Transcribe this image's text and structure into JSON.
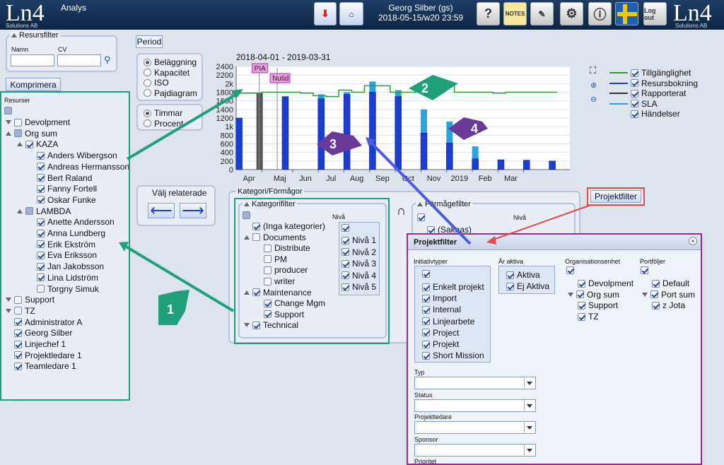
{
  "header": {
    "logo": "Ln4",
    "logo_sub": "Solutions AB",
    "app_name": "Analys",
    "user": "Georg Silber (gs)",
    "datetime": "2018-05-15/w20 23:59",
    "logout_label": "Log out"
  },
  "resource_filter": {
    "title": "Resursfilter",
    "name_label": "Namn",
    "cv_label": "CV",
    "compress_button": "Komprimera"
  },
  "resources": {
    "header": "Resurser",
    "items": [
      {
        "label": "Devolpment",
        "indent": 1,
        "checked": "off",
        "toggle": "collapsed"
      },
      {
        "label": "Org sum",
        "indent": 1,
        "checked": "part",
        "toggle": "expanded"
      },
      {
        "label": "KAZA",
        "indent": 2,
        "checked": "on",
        "toggle": "expanded"
      },
      {
        "label": "Anders Wibergson",
        "indent": 3,
        "checked": "on"
      },
      {
        "label": "Andreas Hermansson",
        "indent": 3,
        "checked": "on"
      },
      {
        "label": "Bert Raland",
        "indent": 3,
        "checked": "on"
      },
      {
        "label": "Fanny Fortell",
        "indent": 3,
        "checked": "on"
      },
      {
        "label": "Oskar Funke",
        "indent": 3,
        "checked": "on"
      },
      {
        "label": "LAMBDA",
        "indent": 2,
        "checked": "part",
        "toggle": "expanded"
      },
      {
        "label": "Anette Andersson",
        "indent": 3,
        "checked": "on"
      },
      {
        "label": "Anna Lundberg",
        "indent": 3,
        "checked": "on"
      },
      {
        "label": "Erik Ekström",
        "indent": 3,
        "checked": "on"
      },
      {
        "label": "Eva Eriksson",
        "indent": 3,
        "checked": "on"
      },
      {
        "label": "Jan Jakobsson",
        "indent": 3,
        "checked": "on"
      },
      {
        "label": "Lina Lidström",
        "indent": 3,
        "checked": "on"
      },
      {
        "label": "Torgny Simuk",
        "indent": 3,
        "checked": "off"
      },
      {
        "label": "Support",
        "indent": 1,
        "checked": "off",
        "toggle": "collapsed"
      },
      {
        "label": "TZ",
        "indent": 1,
        "checked": "off",
        "toggle": "collapsed"
      },
      {
        "label": "Administrator A",
        "indent": 1,
        "checked": "on"
      },
      {
        "label": "Georg Silber",
        "indent": 1,
        "checked": "on"
      },
      {
        "label": "Linjechef 1",
        "indent": 1,
        "checked": "on"
      },
      {
        "label": "Projektledare 1",
        "indent": 1,
        "checked": "on"
      },
      {
        "label": "Teamledare 1",
        "indent": 1,
        "checked": "on"
      }
    ]
  },
  "period": {
    "label": "Period",
    "modes": [
      "Beläggning",
      "Kapacitet",
      "ISO",
      "Pajdiagram"
    ],
    "selected_mode": 0,
    "units": [
      "Timmar",
      "Procent"
    ],
    "selected_unit": 0
  },
  "related": {
    "label": "Välj relaterade"
  },
  "legend": [
    {
      "label": "Tillgänglighet",
      "color": "#2aa02a"
    },
    {
      "label": "Resursbokning",
      "color": "#1a3fd0"
    },
    {
      "label": "Rapporterat",
      "color": "#333333"
    },
    {
      "label": "SLA",
      "color": "#29a3e0"
    },
    {
      "label": "Händelser",
      "color": ""
    }
  ],
  "chart_data": {
    "type": "bar",
    "title": "2018-04-01 - 2019-03-31",
    "categories": [
      "Apr",
      "Maj",
      "Jun",
      "Jul",
      "Aug",
      "Sep",
      "Oct",
      "Nov",
      "2019",
      "Feb",
      "Mar"
    ],
    "y_ticks": [
      "0",
      "200",
      "400",
      "600",
      "800",
      "1k",
      "1200",
      "1400",
      "1600",
      "1800",
      "2k",
      "2200",
      "2400"
    ],
    "ylim": [
      0,
      2400
    ],
    "markers": [
      {
        "label": "PIA",
        "color": "#e9a0e0"
      },
      {
        "label": "Nutid",
        "color": "#e9a0e0"
      }
    ],
    "series": [
      {
        "name": "Resursbokning",
        "color": "#1a3fd0",
        "x": [
          0.1,
          1.9,
          3.3,
          4.3,
          5.3,
          6.3,
          7.3,
          8.3,
          9.3,
          10.3,
          11.3,
          12.3
        ],
        "values": [
          1200,
          1700,
          1650,
          1750,
          1800,
          1700,
          850,
          620,
          250,
          230,
          220,
          200
        ]
      },
      {
        "name": "SLA",
        "color": "#29a3e0",
        "x": [
          0.1,
          1.9,
          3.3,
          4.3,
          5.3,
          6.3,
          7.3,
          8.3,
          9.3,
          10.3,
          11.3,
          12.3
        ],
        "values": [
          1200,
          1700,
          1750,
          1800,
          2050,
          1850,
          1400,
          1120,
          540,
          230,
          220,
          200
        ]
      },
      {
        "name": "Rapporterat",
        "color": "#555555",
        "x": [
          0.9
        ],
        "values": [
          1780
        ]
      },
      {
        "name": "Tillgänglighet",
        "color": "#2aa02a",
        "x": [
          0,
          0.5,
          1,
          1.5,
          2,
          2.5,
          3,
          3.5,
          4,
          4.5,
          5,
          5.5,
          6,
          6.5,
          7,
          7.5,
          8,
          8.5,
          9,
          9.5,
          10,
          10.5,
          11,
          11.5,
          12,
          12.5
        ],
        "values": [
          1780,
          1780,
          1800,
          1800,
          1800,
          1780,
          1720,
          1700,
          1850,
          1800,
          1950,
          1950,
          1800,
          1800,
          1820,
          1800,
          1950,
          1800,
          1800,
          1800,
          1780,
          1800,
          1800,
          1800,
          1800,
          1800
        ]
      }
    ]
  },
  "category_panel": {
    "title": "Kategori/Förmågor",
    "cat_filter": "Kategorifilter",
    "level_title": "Nivå",
    "intersection": "∩",
    "skill_filter": "Förmågefilter",
    "skill_level": "Nivå",
    "skill_first": "(Saknas)",
    "categories": [
      {
        "label": "(Inga kategorier)",
        "indent": 1,
        "checked": "on"
      },
      {
        "label": "Documents",
        "indent": 1,
        "checked": "off",
        "toggle": "expanded"
      },
      {
        "label": "Distribute",
        "indent": 2,
        "checked": "off"
      },
      {
        "label": "PM",
        "indent": 2,
        "checked": "off"
      },
      {
        "label": "producer",
        "indent": 2,
        "checked": "off"
      },
      {
        "label": "writer",
        "indent": 2,
        "checked": "off"
      },
      {
        "label": "Maintenance",
        "indent": 1,
        "checked": "on",
        "toggle": "expanded"
      },
      {
        "label": "Change Mgm",
        "indent": 2,
        "checked": "on"
      },
      {
        "label": "Support",
        "indent": 2,
        "checked": "on"
      },
      {
        "label": "Technical",
        "indent": 1,
        "checked": "on",
        "toggle": "collapsed"
      }
    ],
    "levels": [
      "Nivå 1",
      "Nivå 2",
      "Nivå 3",
      "Nivå 4",
      "Nivå 5"
    ]
  },
  "project_filter_button": "Projektfilter",
  "project_dialog": {
    "title": "Projektfilter",
    "initiative_label": "Initiativtyper",
    "initiatives": [
      "Enkelt projekt",
      "Import",
      "Internal",
      "Linjearbete",
      "Project",
      "Projekt",
      "Short Mission"
    ],
    "active_label": "Är aktiva",
    "active": [
      "Aktiva",
      "Ej Aktiva"
    ],
    "org_label": "Organisationsenhet",
    "orgs": [
      "Devolpment",
      "Org sum",
      "Support",
      "TZ"
    ],
    "portfolio_label": "Portföljer",
    "portfolios": [
      "Default",
      "Port sum",
      "z Jota"
    ],
    "selects": [
      "Typ",
      "Status",
      "Projektledare",
      "Sponsor",
      "Prioritet"
    ]
  },
  "annotations": [
    "1",
    "2",
    "3",
    "4"
  ]
}
